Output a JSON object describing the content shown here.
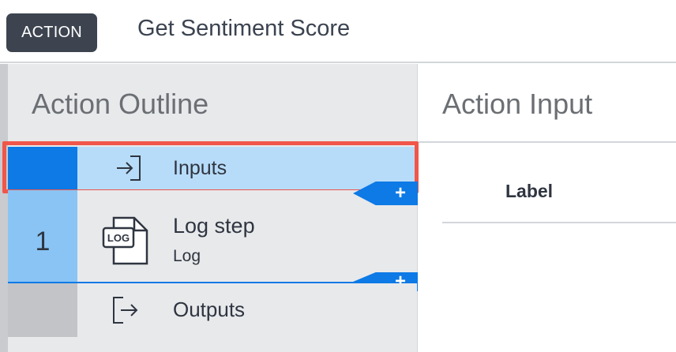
{
  "header": {
    "badge": "ACTION",
    "title": "Get Sentiment Score"
  },
  "outline": {
    "title": "Action Outline",
    "inputs": {
      "label": "Inputs",
      "icon": "input-arrow-icon",
      "add_label": "+"
    },
    "steps": [
      {
        "number": "1",
        "title": "Log step",
        "subtitle": "Log",
        "icon": "log-file-icon",
        "add_label": "+"
      }
    ],
    "outputs": {
      "label": "Outputs",
      "icon": "output-arrow-icon"
    }
  },
  "action_input": {
    "title": "Action Input",
    "columns": [
      "Label"
    ]
  },
  "colors": {
    "accent": "#0d7ae6",
    "selected_row": "#b7dcf9",
    "highlight": "#f0564a",
    "badge_bg": "#3d4450"
  }
}
